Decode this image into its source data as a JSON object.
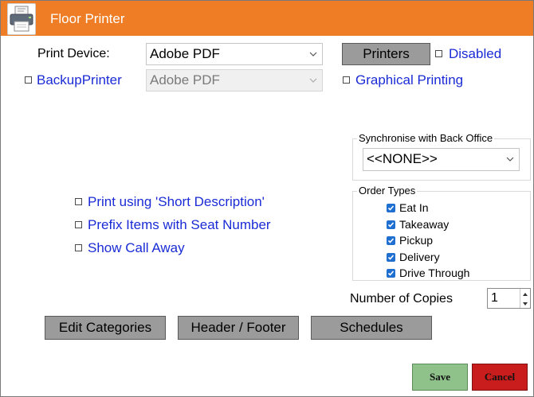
{
  "window": {
    "title": "Floor Printer",
    "accent": "#ee7d25"
  },
  "print_device": {
    "label": "Print Device:",
    "value": "Adobe PDF"
  },
  "printers_button": {
    "label": "Printers"
  },
  "disabled": {
    "label": "Disabled",
    "checked": false
  },
  "backup_printer": {
    "label": "BackupPrinter",
    "checked": false,
    "value": "Adobe PDF"
  },
  "graphical_printing": {
    "label": "Graphical Printing",
    "checked": false
  },
  "sync_back_office": {
    "label": "Synchronise with Back Office",
    "value": "<<NONE>>"
  },
  "options": [
    {
      "label": "Print using 'Short Description'",
      "checked": false
    },
    {
      "label": "Prefix Items with Seat Number",
      "checked": false
    },
    {
      "label": "Show Call Away",
      "checked": false
    }
  ],
  "order_types": {
    "label": "Order Types",
    "items": [
      {
        "label": "Eat In",
        "checked": true
      },
      {
        "label": "Takeaway",
        "checked": true
      },
      {
        "label": "Pickup",
        "checked": true
      },
      {
        "label": "Delivery",
        "checked": true
      },
      {
        "label": "Drive Through",
        "checked": true
      }
    ]
  },
  "copies": {
    "label": "Number of Copies",
    "value": "1"
  },
  "buttons": {
    "edit_categories": "Edit Categories",
    "header_footer": "Header / Footer",
    "schedules": "Schedules",
    "save": "Save",
    "cancel": "Cancel"
  },
  "icons": [
    "printer-icon",
    "chevron-down-icon",
    "check-icon",
    "spin-up-icon",
    "spin-down-icon"
  ]
}
